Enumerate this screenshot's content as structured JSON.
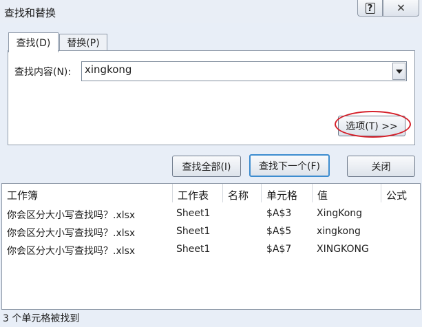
{
  "window": {
    "title": "查找和替换"
  },
  "tabs": [
    {
      "label": "查找(D)",
      "active": true
    },
    {
      "label": "替换(P)",
      "active": false
    }
  ],
  "find": {
    "label": "查找内容(N):",
    "value": "xingkong"
  },
  "buttons": {
    "options": "选项(T) >>",
    "find_all": "查找全部(I)",
    "find_next": "查找下一个(F)",
    "close": "关闭"
  },
  "results": {
    "columns": [
      "工作簿",
      "工作表",
      "名称",
      "单元格",
      "值",
      "公式"
    ],
    "rows": [
      {
        "workbook": "你会区分大小写查找吗？.xlsx",
        "sheet": "Sheet1",
        "name": "",
        "cell": "$A$3",
        "value": "XingKong",
        "formula": ""
      },
      {
        "workbook": "你会区分大小写查找吗？.xlsx",
        "sheet": "Sheet1",
        "name": "",
        "cell": "$A$5",
        "value": "xingkong",
        "formula": ""
      },
      {
        "workbook": "你会区分大小写查找吗？.xlsx",
        "sheet": "Sheet1",
        "name": "",
        "cell": "$A$7",
        "value": "XINGKONG",
        "formula": ""
      }
    ]
  },
  "status": "3 个单元格被找到",
  "icons": {
    "help": "help-icon",
    "close": "close-icon",
    "dropdown": "chevron-down-icon"
  },
  "colors": {
    "highlight": "#d5202a",
    "default_button_border": "#3c8ccf"
  }
}
